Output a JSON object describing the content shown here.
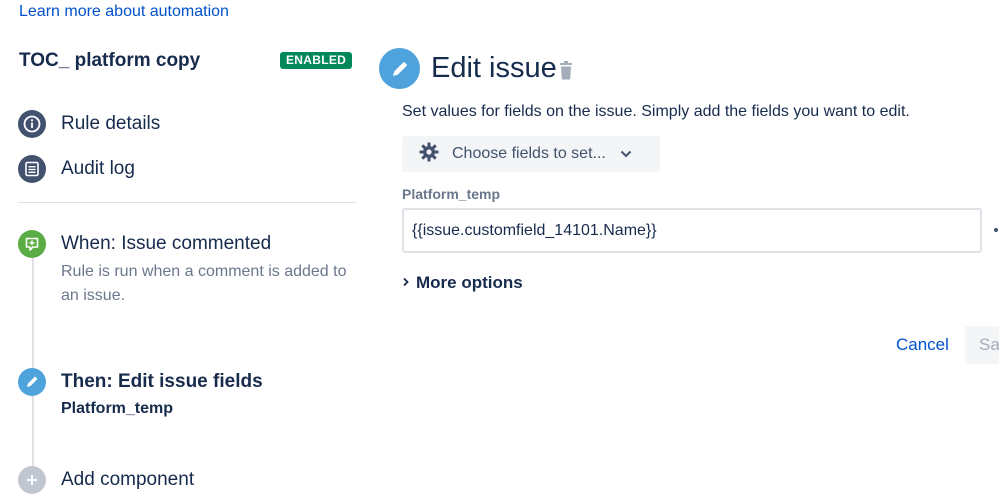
{
  "header": {
    "learn_link": "Learn more about automation"
  },
  "rule": {
    "name": "TOC_ platform copy",
    "status": "ENABLED",
    "status_color": "#00875a"
  },
  "nav": {
    "items": [
      {
        "label": "Rule details",
        "icon": "info-icon"
      },
      {
        "label": "Audit log",
        "icon": "list-icon"
      }
    ]
  },
  "steps": {
    "trigger": {
      "title": "When: Issue commented",
      "description": "Rule is run when a comment is added to an issue.",
      "icon": "comment-plus-icon",
      "color": "#5aac44"
    },
    "action": {
      "title": "Then: Edit issue fields",
      "subtitle": "Platform_temp",
      "icon": "pencil-icon",
      "color": "#4ea3dc"
    },
    "add": {
      "title": "Add component",
      "icon": "plus-icon",
      "color": "#c1c7d0"
    }
  },
  "panel": {
    "title": "Edit issue",
    "help": "Set values for fields on the issue. Simply add the fields you want to edit.",
    "choose_fields": "Choose fields to set...",
    "field_label": "Platform_temp",
    "field_value": "{{issue.customfield_14101.Name}}",
    "more_options": "More options",
    "cancel": "Cancel",
    "save": "Save"
  }
}
